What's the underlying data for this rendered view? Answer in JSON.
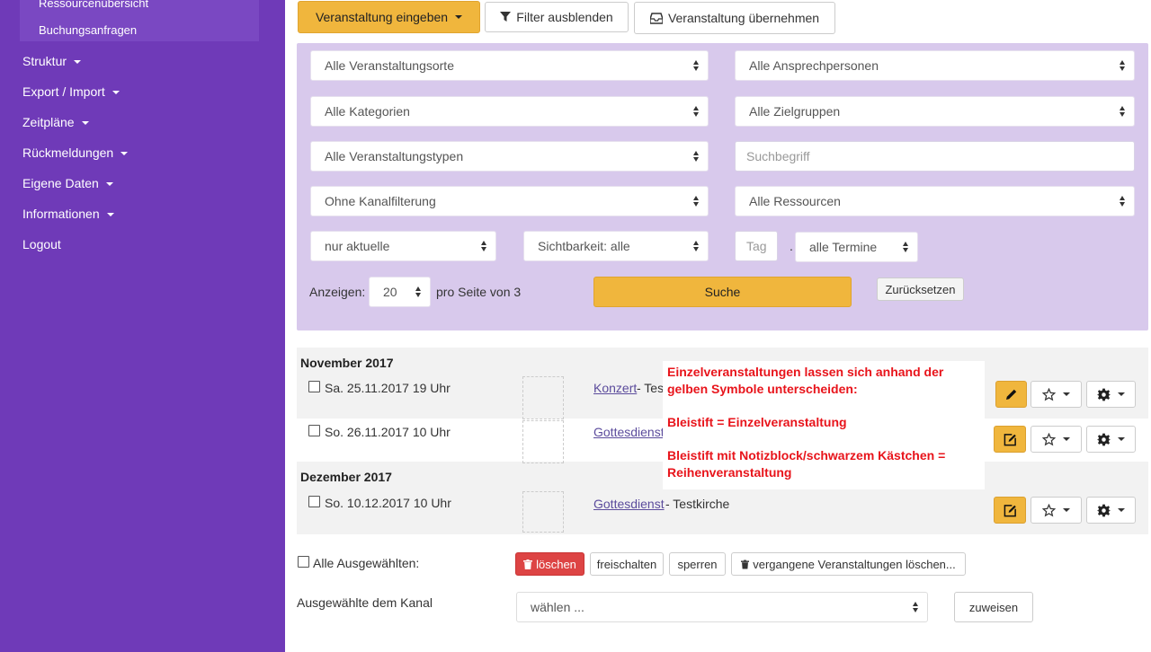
{
  "sidebar": {
    "sub_items": [
      "Ressourcenübersicht",
      "Buchungsanfragen"
    ],
    "items": [
      {
        "label": "Struktur",
        "has_caret": true
      },
      {
        "label": "Export / Import",
        "has_caret": true
      },
      {
        "label": "Zeitpläne",
        "has_caret": true
      },
      {
        "label": "Rückmeldungen",
        "has_caret": true
      },
      {
        "label": "Eigene Daten",
        "has_caret": true
      },
      {
        "label": "Informationen",
        "has_caret": true
      },
      {
        "label": "Logout",
        "has_caret": false
      }
    ]
  },
  "toolbar": {
    "enter_event": "Veranstaltung eingeben",
    "hide_filter": "Filter ausblenden",
    "take_event": "Veranstaltung übernehmen"
  },
  "filters": {
    "venues": "Alle Veranstaltungsorte",
    "contacts": "Alle Ansprechpersonen",
    "categories": "Alle Kategorien",
    "target_groups": "Alle Zielgruppen",
    "event_types": "Alle Veranstaltungstypen",
    "search_placeholder": "Suchbegriff",
    "channel": "Ohne Kanalfilterung",
    "resources": "Alle Ressourcen",
    "current": "nur aktuelle",
    "visibility": "Sichtbarkeit: alle",
    "day_placeholder": "Tag",
    "day_separator": ".",
    "dates": "alle Termine",
    "show_label": "Anzeigen:",
    "per_page": "20",
    "per_page_suffix": "pro Seite von 3",
    "search_button": "Suche",
    "reset_button": "Zurücksetzen"
  },
  "events": {
    "groups": [
      {
        "month": "November 2017"
      },
      {
        "month": "Dezember 2017"
      }
    ],
    "rows": [
      {
        "date": "Sa. 25.11.2017 19 Uhr",
        "title": "Konzert",
        "rest": " - Tes"
      },
      {
        "date": "So. 26.11.2017 10 Uhr",
        "title": "Gottesdienst",
        "rest": ""
      },
      {
        "date": "So. 10.12.2017 10 Uhr",
        "title": "Gottesdienst",
        "rest": " - Testkirche"
      }
    ]
  },
  "annotation": {
    "line1": "Einzelveranstaltungen lassen sich anhand der gelben Symbole unterscheiden:",
    "line2": "Bleistift = Einzelveranstaltung",
    "line3": "Bleistift mit Notizblock/schwarzem Kästchen = Reihenveranstaltung"
  },
  "bulk": {
    "all_selected": "Alle Ausgewählten:",
    "delete": "löschen",
    "unlock": "freischalten",
    "lock": "sperren",
    "delete_past": "vergangene Veranstaltungen löschen...",
    "channel_label": "Ausgewählte dem Kanal",
    "channel_select": "wählen ...",
    "assign": "zuweisen"
  },
  "colors": {
    "sidebar": "#6f3ab8",
    "accent_yellow": "#f0b63d",
    "filter_panel": "#d8c9ec",
    "delete_red": "#dd4444",
    "annotation_red": "#e8141b"
  }
}
